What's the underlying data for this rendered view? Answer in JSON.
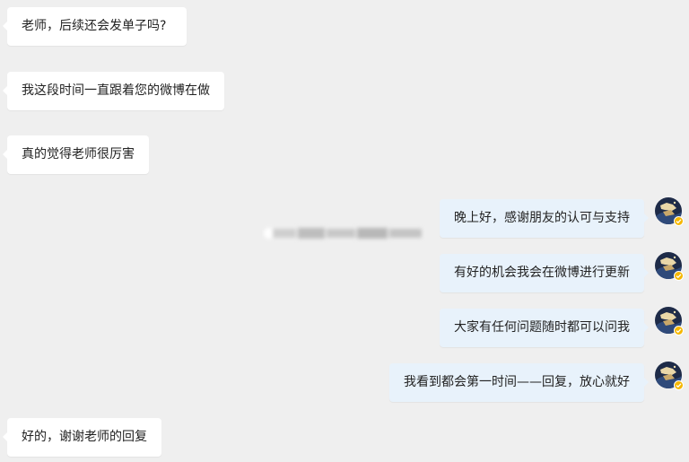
{
  "messages": [
    {
      "side": "in",
      "text": "老师，后续还会发单子吗?"
    },
    {
      "side": "in",
      "text": "我这段时间一直跟着您的微博在做"
    },
    {
      "side": "in",
      "text": "真的觉得老师很厉害"
    },
    {
      "side": "out",
      "text": "晚上好，感谢朋友的认可与支持"
    },
    {
      "side": "out",
      "text": "有好的机会我会在微博进行更新"
    },
    {
      "side": "out",
      "text": "大家有任何问题随时都可以问我"
    },
    {
      "side": "out",
      "text": "我看到都会第一时间——回复，放心就好"
    },
    {
      "side": "in",
      "text": "好的，谢谢老师的回复"
    }
  ],
  "colors": {
    "background": "#efefef",
    "incoming_bubble": "#ffffff",
    "outgoing_bubble": "#e8f2fb",
    "verified_badge": "#f5b700"
  },
  "icons": {
    "avatar": "avatar-icon",
    "verified": "verified-badge-icon"
  }
}
